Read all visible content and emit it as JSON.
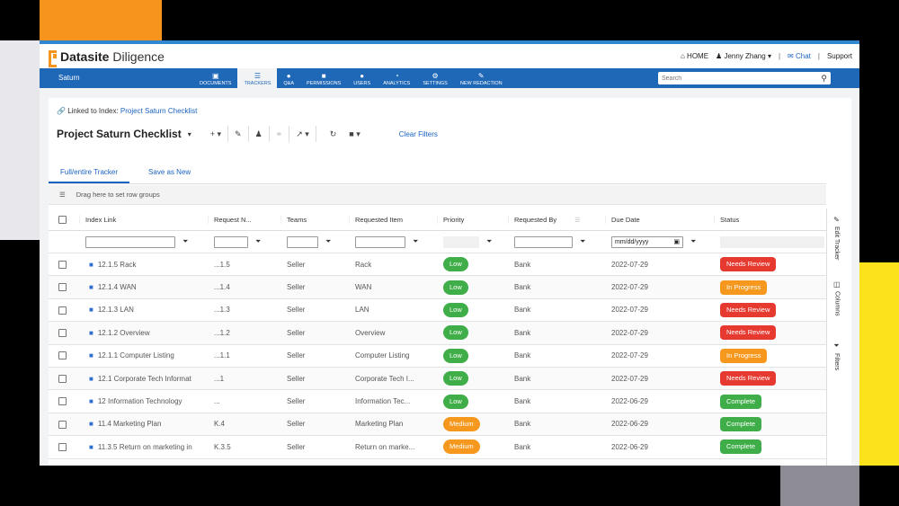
{
  "brand": {
    "name_bold": "Datasite",
    "name_light": "Diligence"
  },
  "header": {
    "home_icon": "home-icon",
    "home_label": "HOME",
    "user_icon": "user-icon",
    "user_name": "Jenny Zhang",
    "chat_icon": "chat-icon",
    "chat_label": "Chat",
    "support_label": "Support",
    "separator": "|"
  },
  "navbar": {
    "project": "Saturn",
    "items": [
      {
        "label": "DOCUMENTS",
        "icon": "document-icon",
        "glyph": "▣"
      },
      {
        "label": "TRACKERS",
        "icon": "list-icon",
        "glyph": "☰"
      },
      {
        "label": "Q&A",
        "icon": "chat-bubble-icon",
        "glyph": "●"
      },
      {
        "label": "PERMISSIONS",
        "icon": "lock-icon",
        "glyph": "■"
      },
      {
        "label": "USERS",
        "icon": "users-icon",
        "glyph": "●"
      },
      {
        "label": "ANALYTICS",
        "icon": "pie-chart-icon",
        "glyph": "◔"
      },
      {
        "label": "SETTINGS",
        "icon": "gear-icon",
        "glyph": "⚙"
      },
      {
        "label": "NEW REDACTION",
        "icon": "redaction-icon",
        "glyph": "✎"
      }
    ],
    "search_placeholder": "Search"
  },
  "page": {
    "linked_prefix": "Linked to Index:",
    "linked_link": "Project Saturn Checklist",
    "title": "Project Saturn Checklist",
    "clear_filters": "Clear Filters",
    "tabs": [
      "Full/entire Tracker",
      "Save as New"
    ],
    "grouping_text": "Drag here to set row groups"
  },
  "table": {
    "columns": [
      "Index Link",
      "Request N...",
      "Teams",
      "Requested Item",
      "Priority",
      "Requested By",
      "Due Date",
      "Status"
    ],
    "date_placeholder": "mm/dd/yyyy",
    "rows": [
      {
        "index": "12.1.5 Rack",
        "req": "...1.5",
        "team": "Seller",
        "item": "Rack",
        "priority": "Low",
        "by": "Bank",
        "due": "2022-07-29",
        "status": "Needs Review"
      },
      {
        "index": "12.1.4 WAN",
        "req": "...1.4",
        "team": "Seller",
        "item": "WAN",
        "priority": "Low",
        "by": "Bank",
        "due": "2022-07-29",
        "status": "In Progress"
      },
      {
        "index": "12.1.3 LAN",
        "req": "...1.3",
        "team": "Seller",
        "item": "LAN",
        "priority": "Low",
        "by": "Bank",
        "due": "2022-07-29",
        "status": "Needs Review"
      },
      {
        "index": "12.1.2 Overview",
        "req": "...1.2",
        "team": "Seller",
        "item": "Overview",
        "priority": "Low",
        "by": "Bank",
        "due": "2022-07-29",
        "status": "Needs Review"
      },
      {
        "index": "12.1.1 Computer Listing",
        "req": "...1.1",
        "team": "Seller",
        "item": "Computer Listing",
        "priority": "Low",
        "by": "Bank",
        "due": "2022-07-29",
        "status": "In Progress"
      },
      {
        "index": "12.1 Corporate Tech Informat",
        "req": "...1",
        "team": "Seller",
        "item": "Corporate Tech I...",
        "priority": "Low",
        "by": "Bank",
        "due": "2022-07-29",
        "status": "Needs Review"
      },
      {
        "index": "12 Information Technology",
        "req": "...",
        "team": "Seller",
        "item": "Information Tec...",
        "priority": "Low",
        "by": "Bank",
        "due": "2022-06-29",
        "status": "Complete"
      },
      {
        "index": "11.4 Marketing Plan",
        "req": "K.4",
        "team": "Seller",
        "item": "Marketing Plan",
        "priority": "Medium",
        "by": "Bank",
        "due": "2022-06-29",
        "status": "Complete"
      },
      {
        "index": "11.3.5 Return on marketing in",
        "req": "K.3.5",
        "team": "Seller",
        "item": "Return on marke...",
        "priority": "Medium",
        "by": "Bank",
        "due": "2022-06-29",
        "status": "Complete"
      }
    ]
  },
  "side_panel": [
    "Edit Tracker",
    "Columns",
    "Filters"
  ],
  "colors": {
    "accent": "#1f67b7",
    "brand_orange": "#f7941d",
    "low": "#3fae49",
    "medium": "#f5981d",
    "needs_review": "#e6392f",
    "in_progress": "#f5981d",
    "complete": "#3fae49"
  }
}
